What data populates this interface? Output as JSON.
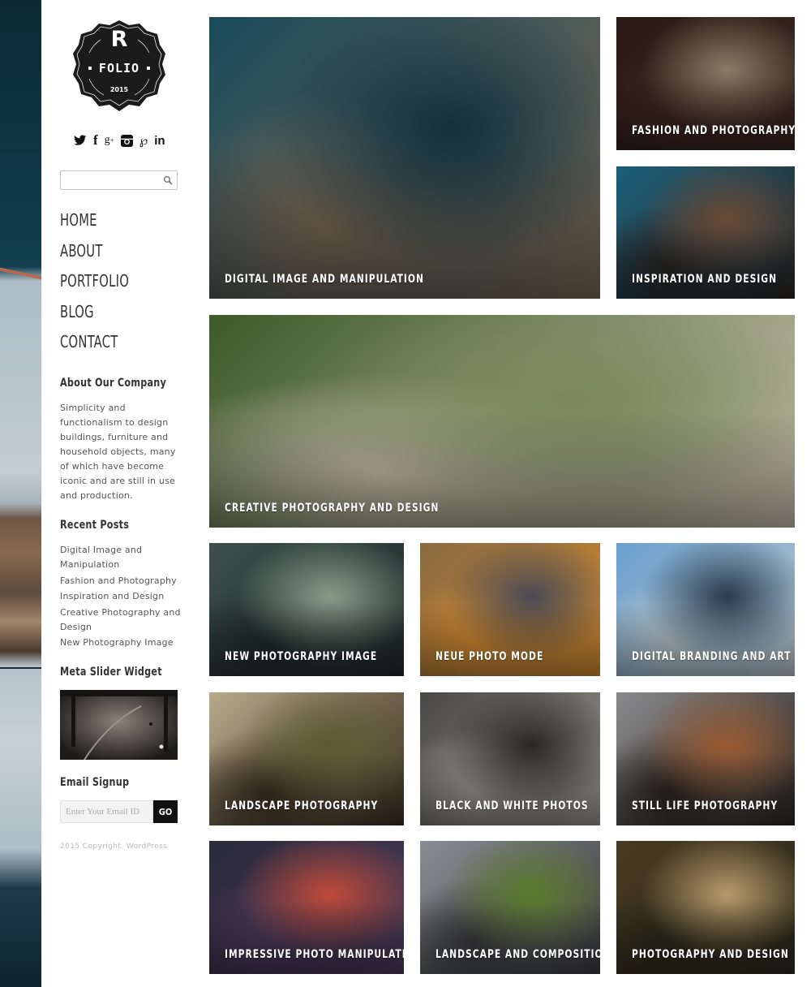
{
  "logo": {
    "letter": "R",
    "name": "FOLIO",
    "year": "2015"
  },
  "social": [
    {
      "name": "twitter",
      "glyph": "🐦"
    },
    {
      "name": "facebook",
      "glyph": "f"
    },
    {
      "name": "google-plus",
      "glyph": "g+"
    },
    {
      "name": "instagram",
      "glyph": "◘"
    },
    {
      "name": "pinterest",
      "glyph": "P"
    },
    {
      "name": "linkedin",
      "glyph": "in"
    }
  ],
  "search": {
    "placeholder": "",
    "value": ""
  },
  "nav": {
    "items": [
      {
        "label": "HOME"
      },
      {
        "label": "ABOUT"
      },
      {
        "label": "PORTFOLIO"
      },
      {
        "label": "BLOG"
      },
      {
        "label": "CONTACT"
      }
    ]
  },
  "about": {
    "title": "About Our Company",
    "text": "Simplicity and functionalism to design buildings, furniture and household objects, many of which have become iconic and are still in use and production."
  },
  "recent_posts": {
    "title": "Recent Posts",
    "items": [
      "Digital Image and Manipulation",
      "Fashion and Photography",
      "Inspiration and Design",
      "Creative Photography and Design",
      "New Photography Image"
    ]
  },
  "meta_slider": {
    "title": "Meta Slider Widget"
  },
  "email_signup": {
    "title": "Email Signup",
    "placeholder": "Enter Your Email ID",
    "button": "GO"
  },
  "copyright": "2015 Copyright. WordPress",
  "portfolio": [
    {
      "caption": "Digital Image and Manipulation",
      "colors": [
        "#1a4a5a",
        "#10303d",
        "#7a6a55"
      ]
    },
    {
      "caption": "Fashion and Photography",
      "colors": [
        "#2a1a16",
        "#8c7a66",
        "#3b2620"
      ]
    },
    {
      "caption": "Inspiration and Design",
      "colors": [
        "#1b5f7a",
        "#6b4a36",
        "#2a2522"
      ]
    },
    {
      "caption": "Creative Photography and Design",
      "colors": [
        "#3d5a2a",
        "#7a8a5a",
        "#c8c0ae"
      ]
    },
    {
      "caption": "New Photography Image",
      "colors": [
        "#3c4f4a",
        "#8a9a88",
        "#1e2a2a"
      ]
    },
    {
      "caption": "Neue Photo Mode",
      "colors": [
        "#8a6a40",
        "#4a4b55",
        "#d28a30"
      ]
    },
    {
      "caption": "Digital Branding and Art",
      "colors": [
        "#6aa0d0",
        "#2a3a4a",
        "#b8c6cc"
      ]
    },
    {
      "caption": "Landscape Photography",
      "colors": [
        "#b7a98a",
        "#5a5a30",
        "#3a2e20"
      ]
    },
    {
      "caption": "Black and White Photos",
      "colors": [
        "#4a4846",
        "#2a2826",
        "#9a9690"
      ]
    },
    {
      "caption": "Still Life Photography",
      "colors": [
        "#8a8a8c",
        "#9a5a30",
        "#2a2420"
      ]
    },
    {
      "caption": "Impressive Photo Manipulation",
      "colors": [
        "#2a2a3a",
        "#c04a3a",
        "#4a3a5a"
      ]
    },
    {
      "caption": "Landscape and Composition",
      "colors": [
        "#8a8e94",
        "#5a7a2a",
        "#3a3a3c"
      ]
    },
    {
      "caption": "Photography and Design",
      "colors": [
        "#4a3a22",
        "#b89a6a",
        "#2a2a1c"
      ]
    }
  ]
}
